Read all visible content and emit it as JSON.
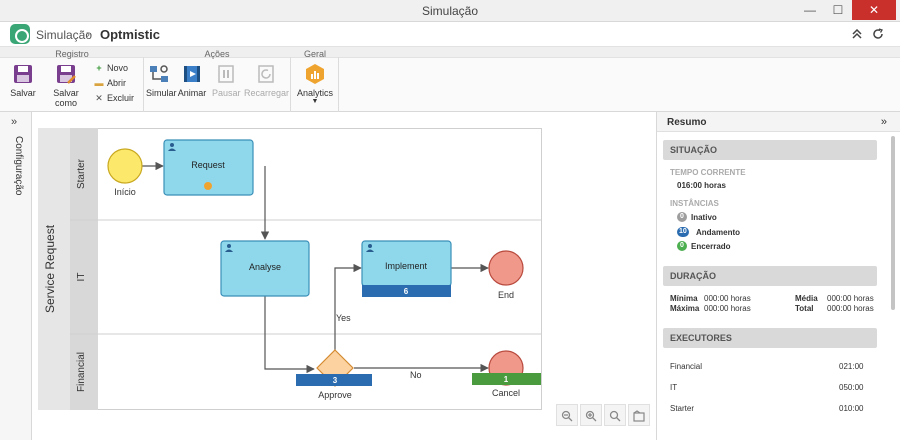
{
  "window": {
    "title": "Simulação",
    "minimize": "—",
    "maximize": "☐",
    "close": "✕"
  },
  "header": {
    "breadcrumb": "Simulação",
    "separator": "›",
    "current": "Optmistic",
    "collapse_icon": "chevron-double-up",
    "refresh_icon": "refresh"
  },
  "ribbon": {
    "groups": [
      "Registro",
      "Ações",
      "Geral"
    ],
    "registro": {
      "save": "Salvar",
      "save_as": "Salvar como",
      "new": "Novo",
      "open": "Abrir",
      "delete": "Excluir"
    },
    "acoes": {
      "simulate": "Simular",
      "animate": "Animar",
      "pause": "Pausar",
      "reload": "Recarregar"
    },
    "geral": {
      "analytics": "Analytics"
    }
  },
  "config_panel": {
    "label": "Configuração",
    "toggle": "»"
  },
  "diagram": {
    "pool": "Service Request",
    "lanes": [
      "Starter",
      "IT",
      "Financial"
    ],
    "nodes": {
      "start": "Início",
      "request": "Request",
      "analyse": "Analyse",
      "implement": "Implement",
      "implement_count": "6",
      "end": "End",
      "approve": "Approve",
      "approve_count": "3",
      "cancel": "Cancel",
      "cancel_count": "1"
    },
    "flows": {
      "yes": "Yes",
      "no": "No"
    }
  },
  "zoom": [
    "zoom-out-icon",
    "zoom-in-icon",
    "zoom-fit-icon",
    "export-icon"
  ],
  "summary": {
    "title": "Resumo",
    "collapse": "»",
    "situacao": {
      "header": "SITUAÇÃO",
      "tempo_label": "TEMPO CORRENTE",
      "tempo_value": "016:00 horas",
      "instancias_label": "INSTÂNCIAS",
      "instancias": [
        {
          "count": "0",
          "label": "Inativo",
          "color": "#9e9e9e"
        },
        {
          "count": "10",
          "label": "Andamento",
          "color": "#2b6cb0"
        },
        {
          "count": "0",
          "label": "Encerrado",
          "color": "#4caf50"
        }
      ]
    },
    "duracao": {
      "header": "DURAÇÃO",
      "min_label": "Mínima",
      "min_value": "000:00 horas",
      "max_label": "Máxima",
      "max_value": "000:00 horas",
      "avg_label": "Média",
      "avg_value": "000:00 horas",
      "total_label": "Total",
      "total_value": "000:00 horas"
    },
    "executores": {
      "header": "EXECUTORES",
      "rows": [
        {
          "name": "Financial",
          "value": "021:00"
        },
        {
          "name": "IT",
          "value": "050:00"
        },
        {
          "name": "Starter",
          "value": "010:00"
        }
      ]
    }
  },
  "colors": {
    "task_fill": "#8fd8ec",
    "task_stroke": "#3a8fb8",
    "start_fill": "#fce86a",
    "end_fill": "#f0988a",
    "gateway_fill": "#fcd3a0",
    "count_blue": "#2b6cb0",
    "count_green": "#4a9a3e"
  }
}
